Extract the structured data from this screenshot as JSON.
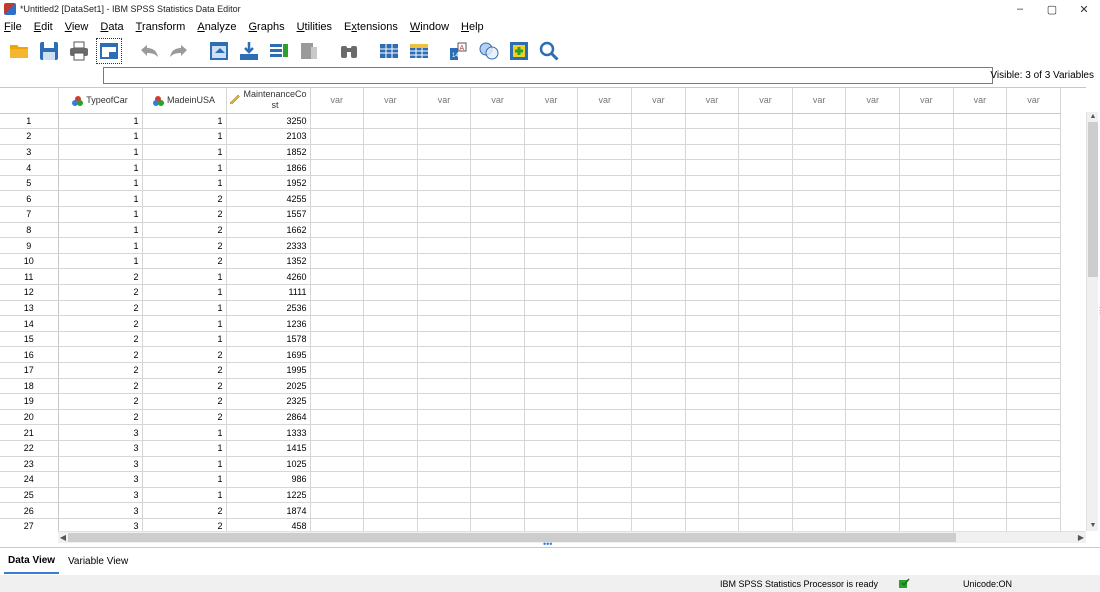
{
  "window": {
    "title": "*Untitled2 [DataSet1] - IBM SPSS Statistics Data Editor",
    "minimize": "–",
    "maximize": "▢",
    "close": "✕"
  },
  "menu": [
    {
      "label": "File",
      "key": "F"
    },
    {
      "label": "Edit",
      "key": "E"
    },
    {
      "label": "View",
      "key": "V"
    },
    {
      "label": "Data",
      "key": "D"
    },
    {
      "label": "Transform",
      "key": "T"
    },
    {
      "label": "Analyze",
      "key": "A"
    },
    {
      "label": "Graphs",
      "key": "G"
    },
    {
      "label": "Utilities",
      "key": "U"
    },
    {
      "label": "Extensions",
      "key": "x"
    },
    {
      "label": "Window",
      "key": "W"
    },
    {
      "label": "Help",
      "key": "H"
    }
  ],
  "toolbar_icons": [
    "open-folder-icon",
    "save-icon",
    "print-icon",
    "recall-dialog-icon",
    "undo-icon",
    "redo-icon",
    "goto-case-icon",
    "goto-variable-icon",
    "variables-icon",
    "run-descriptives-icon",
    "find-icon",
    "insert-cases-icon",
    "insert-variable-icon",
    "split-file-icon",
    "select-cases-icon",
    "value-labels-icon",
    "use-sets-icon",
    "search-icon"
  ],
  "cellbar": {
    "visible_label": "Visible: 3 of 3 Variables"
  },
  "grid": {
    "columns": [
      {
        "name": "TypeofCar",
        "measure": "nominal"
      },
      {
        "name": "MadeinUSA",
        "measure": "nominal"
      },
      {
        "name": "MaintenanceCo\nst",
        "measure": "scale"
      }
    ],
    "empty_header": "var",
    "empty_count": 14,
    "rows": [
      [
        "1",
        "1",
        "1",
        "3250"
      ],
      [
        "2",
        "1",
        "1",
        "2103"
      ],
      [
        "3",
        "1",
        "1",
        "1852"
      ],
      [
        "4",
        "1",
        "1",
        "1866"
      ],
      [
        "5",
        "1",
        "1",
        "1952"
      ],
      [
        "6",
        "1",
        "2",
        "4255"
      ],
      [
        "7",
        "1",
        "2",
        "1557"
      ],
      [
        "8",
        "1",
        "2",
        "1662"
      ],
      [
        "9",
        "1",
        "2",
        "2333"
      ],
      [
        "10",
        "1",
        "2",
        "1352"
      ],
      [
        "11",
        "2",
        "1",
        "4260"
      ],
      [
        "12",
        "2",
        "1",
        "1111"
      ],
      [
        "13",
        "2",
        "1",
        "2536"
      ],
      [
        "14",
        "2",
        "1",
        "1236"
      ],
      [
        "15",
        "2",
        "1",
        "1578"
      ],
      [
        "16",
        "2",
        "2",
        "1695"
      ],
      [
        "17",
        "2",
        "2",
        "1995"
      ],
      [
        "18",
        "2",
        "2",
        "2025"
      ],
      [
        "19",
        "2",
        "2",
        "2325"
      ],
      [
        "20",
        "2",
        "2",
        "2864"
      ],
      [
        "21",
        "3",
        "1",
        "1333"
      ],
      [
        "22",
        "3",
        "1",
        "1415"
      ],
      [
        "23",
        "3",
        "1",
        "1025"
      ],
      [
        "24",
        "3",
        "1",
        "986"
      ],
      [
        "25",
        "3",
        "1",
        "1225"
      ],
      [
        "26",
        "3",
        "2",
        "1874"
      ],
      [
        "27",
        "3",
        "2",
        "458"
      ]
    ]
  },
  "tabs": {
    "data_view": "Data View",
    "variable_view": "Variable View"
  },
  "status": {
    "processor": "IBM SPSS Statistics Processor is ready",
    "unicode": "Unicode:ON"
  }
}
